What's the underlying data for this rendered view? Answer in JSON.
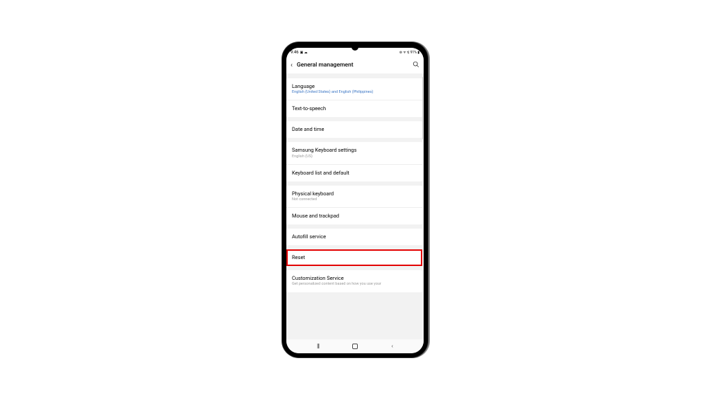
{
  "status": {
    "time": "9:46",
    "icons_left": "▣ ☁",
    "icons_right": "⊚ ᯤ ⫯| 91% ▮"
  },
  "header": {
    "title": "General management"
  },
  "groups": [
    {
      "items": [
        {
          "title": "Language",
          "sub": "English (United States) and English (Philippines)",
          "subClass": "blue"
        },
        {
          "title": "Text-to-speech"
        }
      ]
    },
    {
      "items": [
        {
          "title": "Date and time"
        }
      ]
    },
    {
      "items": [
        {
          "title": "Samsung Keyboard settings",
          "sub": "English (US)"
        },
        {
          "title": "Keyboard list and default"
        }
      ]
    },
    {
      "items": [
        {
          "title": "Physical keyboard",
          "sub": "Not connected"
        },
        {
          "title": "Mouse and trackpad"
        }
      ]
    },
    {
      "items": [
        {
          "title": "Autofill service"
        }
      ]
    },
    {
      "items": [
        {
          "title": "Reset",
          "highlight": true
        }
      ]
    },
    {
      "items": [
        {
          "title": "Customization Service",
          "sub": "Get personalized content based on how you use your"
        }
      ]
    }
  ]
}
